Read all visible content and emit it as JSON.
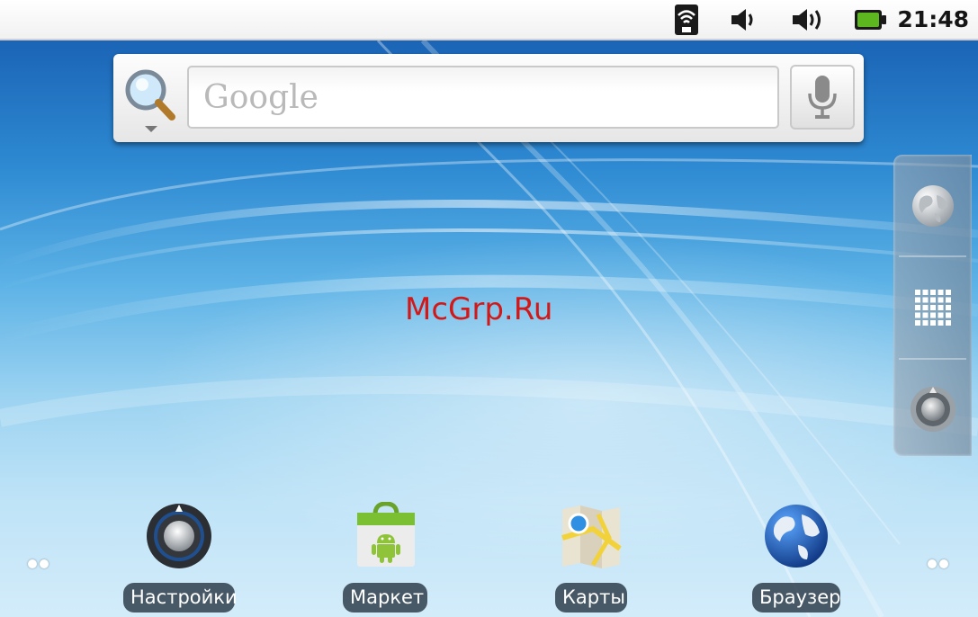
{
  "status_bar": {
    "time": "21:48",
    "icons": [
      "wifi-icon",
      "media-volume-icon",
      "ringer-volume-icon",
      "battery-icon"
    ],
    "battery_color": "#5cb81e"
  },
  "search": {
    "placeholder": "Google",
    "value": "",
    "search_icon": "search-icon",
    "mic_icon": "microphone-icon"
  },
  "right_dock": {
    "buttons": [
      "globe-icon",
      "app-grid-icon",
      "settings-knob-icon"
    ]
  },
  "watermark": "McGrp.Ru",
  "shortcuts": [
    {
      "label": "Настройки",
      "icon": "settings-icon"
    },
    {
      "label": "Маркет",
      "icon": "market-icon"
    },
    {
      "label": "Карты",
      "icon": "maps-icon"
    },
    {
      "label": "Браузер",
      "icon": "browser-icon"
    }
  ],
  "page_indicators": [
    "left-page-dots",
    "right-page-dots"
  ]
}
